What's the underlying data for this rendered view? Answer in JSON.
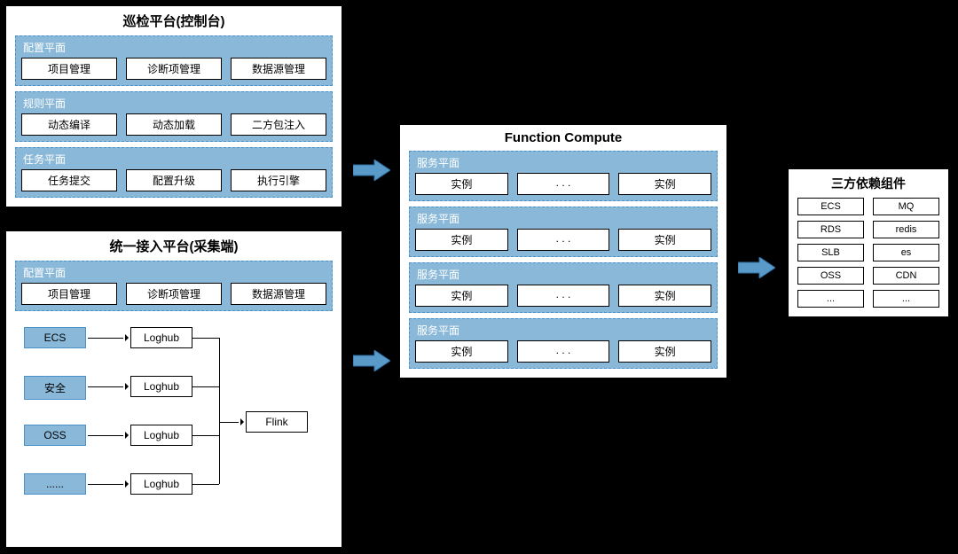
{
  "inspection": {
    "title": "巡检平台(控制台)",
    "planes": [
      {
        "title": "配置平面",
        "items": [
          "项目管理",
          "诊断项管理",
          "数据源管理"
        ]
      },
      {
        "title": "规则平面",
        "items": [
          "动态编译",
          "动态加载",
          "二方包注入"
        ]
      },
      {
        "title": "任务平面",
        "items": [
          "任务提交",
          "配置升级",
          "执行引擎"
        ]
      }
    ]
  },
  "access": {
    "title": "统一接入平台(采集端)",
    "plane": {
      "title": "配置平面",
      "items": [
        "项目管理",
        "诊断项管理",
        "数据源管理"
      ]
    },
    "sources": [
      "ECS",
      "安全",
      "OSS",
      "......"
    ],
    "loghub": "Loghub",
    "sink": "Flink"
  },
  "fc": {
    "title": "Function Compute",
    "plane_title": "服务平面",
    "instance": "实例",
    "dots": ". . ."
  },
  "deps": {
    "title": "三方依赖组件",
    "items": [
      "ECS",
      "MQ",
      "RDS",
      "redis",
      "SLB",
      "es",
      "OSS",
      "CDN",
      "...",
      "..."
    ]
  }
}
